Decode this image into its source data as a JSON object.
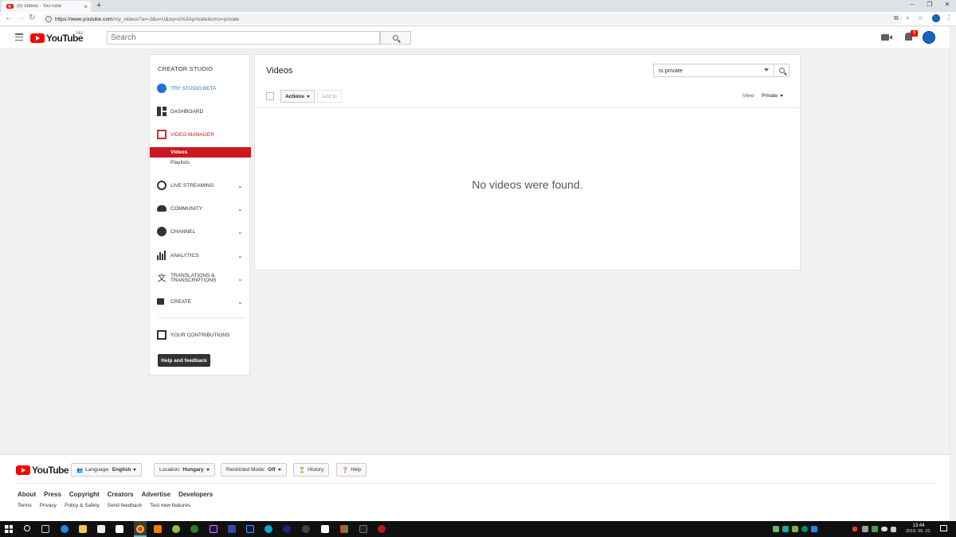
{
  "browser": {
    "tab_title": "(9) Videos - YouTube",
    "tab_close": "×",
    "new_tab": "+",
    "url_host": "https://www.youtube.com",
    "url_path": "/my_videos?ar=3&o=U&sq=is%3Aprivate&vmo=private",
    "window_controls": [
      "–",
      "❐",
      "✕"
    ]
  },
  "masthead": {
    "logo_text": "YouTube",
    "country": "HU",
    "search_placeholder": "Search",
    "notification_count": "9"
  },
  "sidenav": {
    "title": "CREATOR STUDIO",
    "try_studio": "TRY STUDIO BETA",
    "dashboard": "DASHBOARD",
    "video_manager": "VIDEO MANAGER",
    "videos": "Videos",
    "playlists": "Playlists",
    "live_streaming": "LIVE STREAMING",
    "community": "COMMUNITY",
    "channel": "CHANNEL",
    "analytics": "ANALYTICS",
    "translations": "TRANSLATIONS & TRANSCRIPTIONS",
    "create": "CREATE",
    "contributions": "YOUR CONTRIBUTIONS",
    "help": "Help and feedback"
  },
  "main": {
    "title": "Videos",
    "filter_value": "is:private",
    "actions_label": "Actions",
    "add_to_label": "Add to",
    "view_label": "View:",
    "view_value": "Private",
    "empty_message": "No videos were found."
  },
  "footer": {
    "language_label": "Language:",
    "language_value": "English",
    "location_label": "Location:",
    "location_value": "Hungary",
    "restricted_label": "Restricted Mode:",
    "restricted_value": "Off",
    "history": "History",
    "help": "Help",
    "links_primary": [
      "About",
      "Press",
      "Copyright",
      "Creators",
      "Advertise",
      "Developers"
    ],
    "links_secondary": [
      "Terms",
      "Privacy",
      "Policy & Safety",
      "Send feedback",
      "Test new features"
    ]
  },
  "taskbar": {
    "time": "13:44",
    "date": "2019. 06. 22."
  },
  "colors": {
    "youtube_red": "#ff0000",
    "active_nav": "#cc181e",
    "studio_blue": "#1e73d8"
  }
}
